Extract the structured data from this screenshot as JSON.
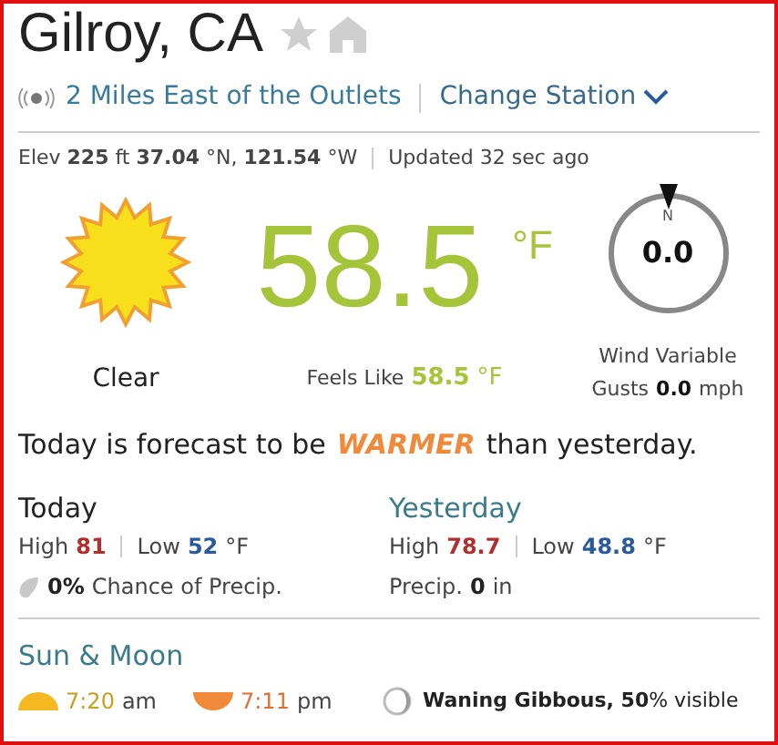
{
  "location": {
    "title": "Gilroy, CA",
    "favorite": false
  },
  "station": {
    "name": "2 Miles East of the Outlets",
    "change_label": "Change Station"
  },
  "meta": {
    "elevation": "Elev **225** ft **37.04** °N, **121.54** °W",
    "updated": "Updated 32 sec ago"
  },
  "current": {
    "condition": "Clear",
    "temperature": "58.5",
    "unit": "°F",
    "feels_like_label": "Feels Like",
    "feels_like_value": "58.5",
    "feels_like_unit": "°F"
  },
  "wind": {
    "compass_label": "N",
    "speed": "0.0",
    "direction": "Wind Variable",
    "gusts_label": "Gusts",
    "gusts_value": "0.0",
    "gusts_unit": "mph"
  },
  "forecast_sentence": {
    "before": "Today is forecast to be",
    "highlight": "WARMER",
    "after": "than yesterday."
  },
  "today": {
    "title": "Today",
    "high_label": "High",
    "high": "81",
    "low_label": "Low",
    "low": "52",
    "unit": "°F",
    "precip_value": "0%",
    "precip_label": "Chance of Precip."
  },
  "yesterday": {
    "title": "Yesterday",
    "high_label": "High",
    "high": "78.7",
    "low_label": "Low",
    "low": "48.8",
    "unit": "°F",
    "precip_label": "Precip.",
    "precip_value": "0",
    "precip_unit": "in"
  },
  "sun_moon": {
    "title": "Sun & Moon",
    "sunrise_time": "7:20",
    "sunrise_suffix": "am",
    "sunset_time": "7:11",
    "sunset_suffix": "pm",
    "moon": "**Waning Gibbous, 50**% visible"
  }
}
